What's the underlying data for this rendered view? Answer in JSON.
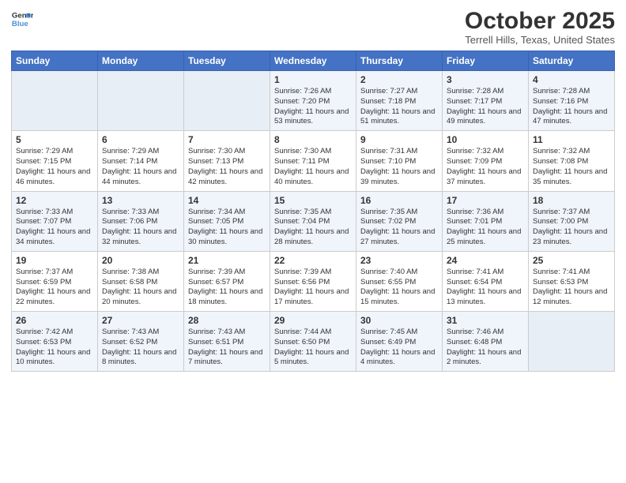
{
  "logo": {
    "line1": "General",
    "line2": "Blue"
  },
  "title": "October 2025",
  "subtitle": "Terrell Hills, Texas, United States",
  "days_of_week": [
    "Sunday",
    "Monday",
    "Tuesday",
    "Wednesday",
    "Thursday",
    "Friday",
    "Saturday"
  ],
  "weeks": [
    [
      {
        "day": "",
        "info": ""
      },
      {
        "day": "",
        "info": ""
      },
      {
        "day": "",
        "info": ""
      },
      {
        "day": "1",
        "info": "Sunrise: 7:26 AM\nSunset: 7:20 PM\nDaylight: 11 hours and 53 minutes."
      },
      {
        "day": "2",
        "info": "Sunrise: 7:27 AM\nSunset: 7:18 PM\nDaylight: 11 hours and 51 minutes."
      },
      {
        "day": "3",
        "info": "Sunrise: 7:28 AM\nSunset: 7:17 PM\nDaylight: 11 hours and 49 minutes."
      },
      {
        "day": "4",
        "info": "Sunrise: 7:28 AM\nSunset: 7:16 PM\nDaylight: 11 hours and 47 minutes."
      }
    ],
    [
      {
        "day": "5",
        "info": "Sunrise: 7:29 AM\nSunset: 7:15 PM\nDaylight: 11 hours and 46 minutes."
      },
      {
        "day": "6",
        "info": "Sunrise: 7:29 AM\nSunset: 7:14 PM\nDaylight: 11 hours and 44 minutes."
      },
      {
        "day": "7",
        "info": "Sunrise: 7:30 AM\nSunset: 7:13 PM\nDaylight: 11 hours and 42 minutes."
      },
      {
        "day": "8",
        "info": "Sunrise: 7:30 AM\nSunset: 7:11 PM\nDaylight: 11 hours and 40 minutes."
      },
      {
        "day": "9",
        "info": "Sunrise: 7:31 AM\nSunset: 7:10 PM\nDaylight: 11 hours and 39 minutes."
      },
      {
        "day": "10",
        "info": "Sunrise: 7:32 AM\nSunset: 7:09 PM\nDaylight: 11 hours and 37 minutes."
      },
      {
        "day": "11",
        "info": "Sunrise: 7:32 AM\nSunset: 7:08 PM\nDaylight: 11 hours and 35 minutes."
      }
    ],
    [
      {
        "day": "12",
        "info": "Sunrise: 7:33 AM\nSunset: 7:07 PM\nDaylight: 11 hours and 34 minutes."
      },
      {
        "day": "13",
        "info": "Sunrise: 7:33 AM\nSunset: 7:06 PM\nDaylight: 11 hours and 32 minutes."
      },
      {
        "day": "14",
        "info": "Sunrise: 7:34 AM\nSunset: 7:05 PM\nDaylight: 11 hours and 30 minutes."
      },
      {
        "day": "15",
        "info": "Sunrise: 7:35 AM\nSunset: 7:04 PM\nDaylight: 11 hours and 28 minutes."
      },
      {
        "day": "16",
        "info": "Sunrise: 7:35 AM\nSunset: 7:02 PM\nDaylight: 11 hours and 27 minutes."
      },
      {
        "day": "17",
        "info": "Sunrise: 7:36 AM\nSunset: 7:01 PM\nDaylight: 11 hours and 25 minutes."
      },
      {
        "day": "18",
        "info": "Sunrise: 7:37 AM\nSunset: 7:00 PM\nDaylight: 11 hours and 23 minutes."
      }
    ],
    [
      {
        "day": "19",
        "info": "Sunrise: 7:37 AM\nSunset: 6:59 PM\nDaylight: 11 hours and 22 minutes."
      },
      {
        "day": "20",
        "info": "Sunrise: 7:38 AM\nSunset: 6:58 PM\nDaylight: 11 hours and 20 minutes."
      },
      {
        "day": "21",
        "info": "Sunrise: 7:39 AM\nSunset: 6:57 PM\nDaylight: 11 hours and 18 minutes."
      },
      {
        "day": "22",
        "info": "Sunrise: 7:39 AM\nSunset: 6:56 PM\nDaylight: 11 hours and 17 minutes."
      },
      {
        "day": "23",
        "info": "Sunrise: 7:40 AM\nSunset: 6:55 PM\nDaylight: 11 hours and 15 minutes."
      },
      {
        "day": "24",
        "info": "Sunrise: 7:41 AM\nSunset: 6:54 PM\nDaylight: 11 hours and 13 minutes."
      },
      {
        "day": "25",
        "info": "Sunrise: 7:41 AM\nSunset: 6:53 PM\nDaylight: 11 hours and 12 minutes."
      }
    ],
    [
      {
        "day": "26",
        "info": "Sunrise: 7:42 AM\nSunset: 6:53 PM\nDaylight: 11 hours and 10 minutes."
      },
      {
        "day": "27",
        "info": "Sunrise: 7:43 AM\nSunset: 6:52 PM\nDaylight: 11 hours and 8 minutes."
      },
      {
        "day": "28",
        "info": "Sunrise: 7:43 AM\nSunset: 6:51 PM\nDaylight: 11 hours and 7 minutes."
      },
      {
        "day": "29",
        "info": "Sunrise: 7:44 AM\nSunset: 6:50 PM\nDaylight: 11 hours and 5 minutes."
      },
      {
        "day": "30",
        "info": "Sunrise: 7:45 AM\nSunset: 6:49 PM\nDaylight: 11 hours and 4 minutes."
      },
      {
        "day": "31",
        "info": "Sunrise: 7:46 AM\nSunset: 6:48 PM\nDaylight: 11 hours and 2 minutes."
      },
      {
        "day": "",
        "info": ""
      }
    ]
  ]
}
